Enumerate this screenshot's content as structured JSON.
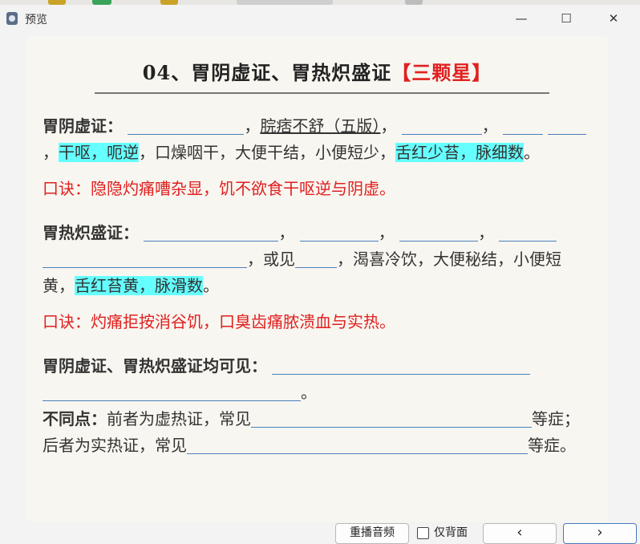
{
  "window": {
    "title": "预览",
    "minimize": "—",
    "maximize": "☐",
    "close": "✕"
  },
  "heading": {
    "prefix": "04、胃阴虚证、胃热炽盛证",
    "tag": "【三颗星】"
  },
  "s1": {
    "label": "胃阴虚证：",
    "p1": "，",
    "u1": "脘痞不舒（五版）",
    "p2": "，",
    "p3": "，",
    "p4": "，",
    "h1": "干呕，呃逆",
    "t1": "，口燥咽干，大便干结，小便短少，",
    "h2": "舌红少苔，脉细数",
    "end": "。",
    "mnemonic": "口诀：隐隐灼痛嘈杂显，饥不欲食干呕逆与阴虚。"
  },
  "s2": {
    "label": "胃热炽盛证：",
    "p1": "，",
    "p2": "，",
    "p3": "，",
    "t1": "，或见",
    "t2": "，渴喜冷饮，大便秘结，小便短黄，",
    "h1": "舌红苔黄，脉滑数",
    "end": "。",
    "mnemonic": "口诀：灼痛拒按消谷饥，口臭齿痛脓溃血与实热。"
  },
  "s3": {
    "label": "胃阴虚证、胃热炽盛证均可见：",
    "end": "。",
    "diff_label": "不同点：",
    "t1": "前者为虚热证，常见",
    "t2": "等症；后者为实热证，常见",
    "t3": "等症。"
  },
  "bottom": {
    "replay": "重播音频",
    "checkbox_label": "仅背面",
    "prev": "‹",
    "next": "›"
  }
}
